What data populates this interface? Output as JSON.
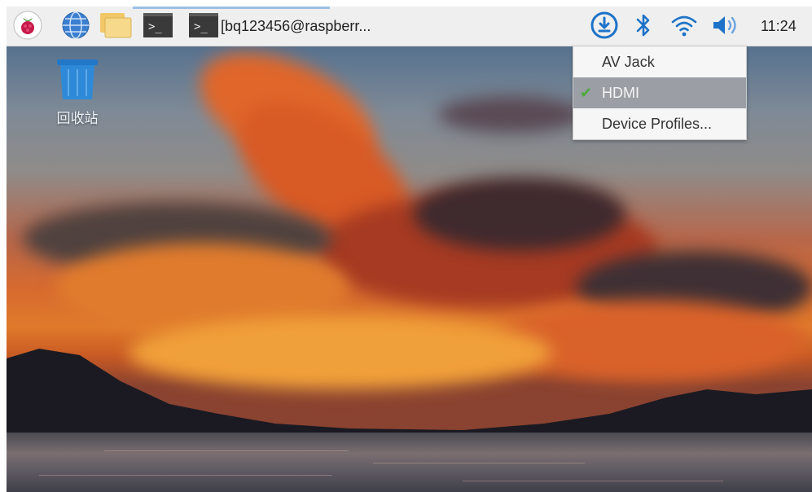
{
  "taskbar": {
    "task_label": "[bq123456@raspberr...",
    "terminal_prompt": ">_",
    "clock": "11:24"
  },
  "desktop": {
    "trash_label": "回收站"
  },
  "audio_menu": {
    "items": [
      {
        "label": "AV Jack",
        "checked": false
      },
      {
        "label": "HDMI",
        "checked": true
      },
      {
        "label": "Device Profiles...",
        "checked": false
      }
    ]
  },
  "icons": [
    "raspberry-menu-icon",
    "web-browser-icon",
    "file-manager-icon",
    "terminal-icon",
    "download-update-icon",
    "bluetooth-icon",
    "wifi-icon",
    "volume-icon",
    "trash-icon",
    "check-icon"
  ],
  "colors": {
    "panel": "#efefef",
    "accent_blue": "#1e73c8",
    "menu_selected": "#9b9fa5",
    "check_green": "#4caa3a"
  }
}
